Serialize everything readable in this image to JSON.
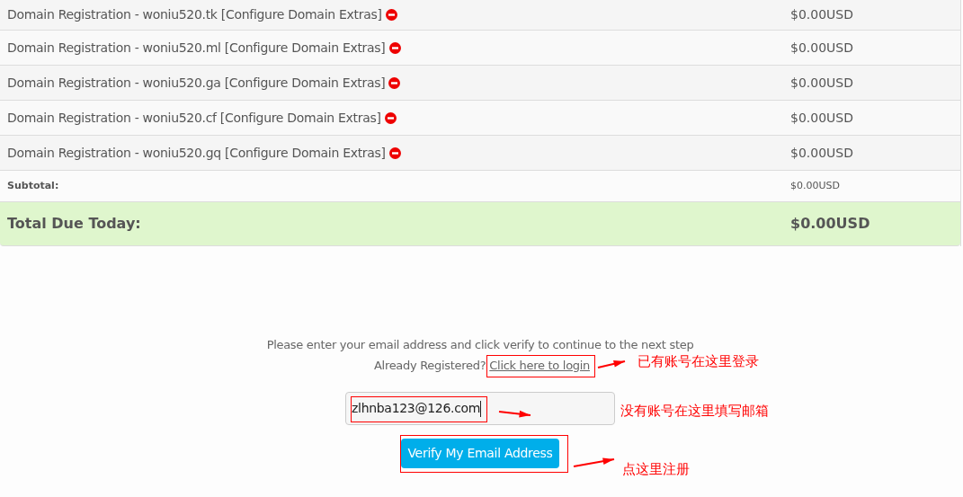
{
  "cart": {
    "items": [
      {
        "description": "Domain Registration - woniu520.tk [Configure Domain Extras]",
        "price": "$0.00USD"
      },
      {
        "description": "Domain Registration - woniu520.ml [Configure Domain Extras]",
        "price": "$0.00USD"
      },
      {
        "description": "Domain Registration - woniu520.ga [Configure Domain Extras]",
        "price": "$0.00USD"
      },
      {
        "description": "Domain Registration - woniu520.cf [Configure Domain Extras]",
        "price": "$0.00USD"
      },
      {
        "description": "Domain Registration - woniu520.gq [Configure Domain Extras]",
        "price": "$0.00USD"
      }
    ],
    "subtotal": {
      "label": "Subtotal:",
      "value": "$0.00USD"
    },
    "total": {
      "label": "Total Due Today:",
      "value": "$0.00USD"
    }
  },
  "verify": {
    "instruction": "Please enter your email address and click verify to continue to the next step",
    "registered_prompt": "Already Registered?",
    "login_link": "Click here to login",
    "email": "zlhnba123@126.com",
    "button": "Verify My Email Address"
  },
  "annotations": [
    {
      "text": "已有账号在这里登录"
    },
    {
      "text": "没有账号在这里填写邮箱"
    },
    {
      "text": "点这里注册"
    }
  ]
}
